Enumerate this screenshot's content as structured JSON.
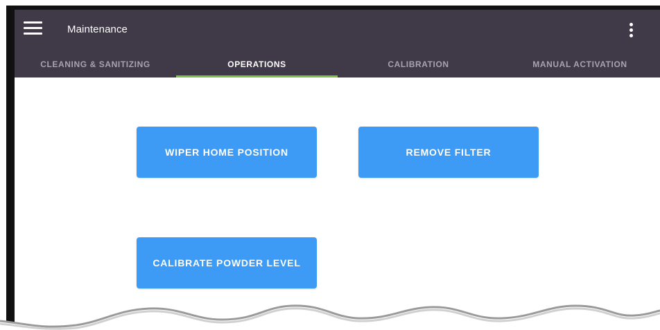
{
  "header": {
    "title": "Maintenance",
    "menu_icon": "hamburger-menu-icon",
    "overflow_icon": "more-vertical-icon",
    "background_color": "#3f3948"
  },
  "tabs": [
    {
      "label": "CLEANING & SANITIZING",
      "active": false
    },
    {
      "label": "OPERATIONS",
      "active": true
    },
    {
      "label": "CALIBRATION",
      "active": false
    },
    {
      "label": "MANUAL ACTIVATION",
      "active": false
    }
  ],
  "active_tab_indicator_color": "#7fc142",
  "actions": {
    "wiper_home_position": "WIPER HOME POSITION",
    "remove_filter": "REMOVE FILTER",
    "calibrate_powder_level": "CALIBRATE POWDER LEVEL",
    "button_color": "#3d9bf5"
  }
}
